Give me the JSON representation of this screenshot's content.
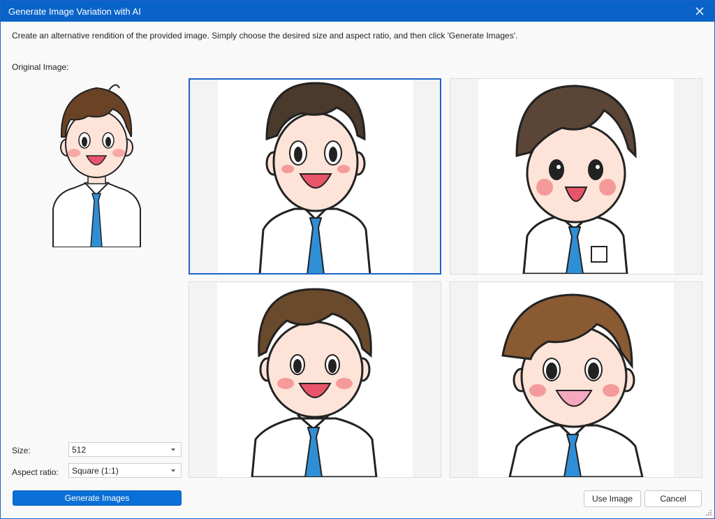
{
  "dialog": {
    "title": "Generate Image Variation with AI",
    "description": "Create an alternative rendition of the provided image. Simply choose the desired size and aspect ratio, and then click 'Generate Images'.",
    "original_label": "Original Image:"
  },
  "fields": {
    "size_label": "Size:",
    "size_value": "512",
    "aspect_label": "Aspect ratio:",
    "aspect_value": "Square (1:1)"
  },
  "buttons": {
    "generate": "Generate Images",
    "use_image": "Use Image",
    "cancel": "Cancel"
  },
  "variations": [
    {
      "selected": true,
      "hair": "#4a3a2c"
    },
    {
      "selected": false,
      "hair": "#5b4536"
    },
    {
      "selected": false,
      "hair": "#6a4a2c"
    },
    {
      "selected": false,
      "hair": "#8a5a32"
    }
  ],
  "colors": {
    "accent": "#0a63c9",
    "tie": "#2f8fd6",
    "skin": "#fde3d8",
    "blush": "#f59a9a"
  },
  "icons": {
    "close": "close-icon",
    "resize": "resize-grip-icon"
  }
}
